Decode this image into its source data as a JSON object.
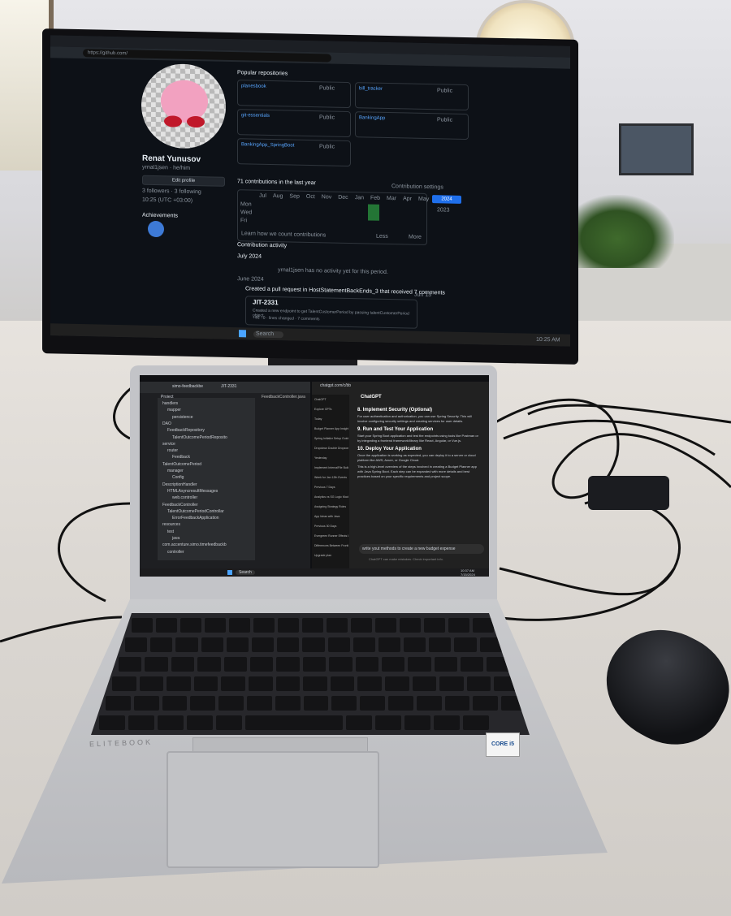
{
  "monitor": {
    "browser_url": "https://github.com/",
    "profile": {
      "name": "Renat Yunusov",
      "handle": "yrnal1jsen · he/him",
      "edit_button": "Edit profile",
      "followers": "3 followers · 3 following",
      "location": "10:25 (UTC +03:00)",
      "achievements_label": "Achievements"
    },
    "popular_heading": "Popular repositories",
    "repos": [
      {
        "name": "planesbook",
        "visibility": "Public"
      },
      {
        "name": "bill_tracker",
        "visibility": "Public"
      },
      {
        "name": "git-essentials",
        "visibility": "Public"
      },
      {
        "name": "BankingApp",
        "visibility": "Public"
      },
      {
        "name": "BankingApp_SpringBoot",
        "visibility": "Public"
      }
    ],
    "contributions_heading": "71 contributions in the last year",
    "contribution_settings": "Contribution settings",
    "year_button": "2024",
    "year_alt": "2023",
    "months": [
      "Jul",
      "Aug",
      "Sep",
      "Oct",
      "Nov",
      "Dec",
      "Jan",
      "Feb",
      "Mar",
      "Apr",
      "May",
      "Jun"
    ],
    "days": [
      "Mon",
      "Wed",
      "Fri"
    ],
    "learn_link": "Learn how we count contributions",
    "legend_less": "Less",
    "legend_more": "More",
    "activity_heading": "Contribution activity",
    "activity_month": "July 2024",
    "no_activity": "yrnal1jsen has no activity yet for this period.",
    "june_label": "June 2024",
    "pr_text": "Created a pull request in HostStatementBackEnds_3 that received 7 comments",
    "pr_date": "Jun 13",
    "pr_title": "JIT-2331",
    "pr_desc": "Created a new endpoint to get TalentCustomerPeriod by passing talentCustomerPeriod object",
    "pr_stats": "+46 −0 · lines changed · 7 comments",
    "search_label": "Search",
    "clock": "10:25 AM"
  },
  "laptop": {
    "ide": {
      "project_label": "Project",
      "tree": [
        "handlers",
        "mapper",
        "persistence",
        "DAO",
        "FeedbackRepository",
        "TalentOutcomePeriodReposito",
        "service",
        "router",
        "Feedback",
        "TalentOutcomePeriod",
        "manager",
        "Config",
        "DescriptionHandler",
        "HTMLAsyncresultMessages",
        "web.controller",
        "FeedbackController",
        "TalentOutcomePeriodControllar",
        "ErrorFeedbackApplication",
        "resources",
        "test",
        "java",
        "com.accenture.simo.timefeedbackb",
        "controller"
      ],
      "tab": "FeedbackController.java",
      "branch": "JIT-2331",
      "app": "simo-feedbackbe"
    },
    "chat": {
      "title": "ChatGPT",
      "url": "chatgpt.com/c/bb",
      "sidebar": [
        "ChatGPT",
        "Explore GPTs",
        "Today",
        "Budget Planner App Insights",
        "Spring Initializr Setup Guide",
        "Dropdown Double Dropzoning",
        "Yesterday",
        "Implement InternalFile Builder",
        "Week for Jan 12th Events",
        "Previous 7 Days",
        "Analytics vs SG Logic Models",
        "Assigning Strategy Roles",
        "App Ideas with Java",
        "Previous 30 Days",
        "Evergreen Runner Effects List",
        "Differences Between Frontiers",
        "Upgrade plan"
      ],
      "sections": [
        {
          "heading": "8. Implement Security (Optional)",
          "body": "For user authentication and authorization, you can use Spring Security. This will involve configuring security settings and creating services for user details."
        },
        {
          "heading": "9. Run and Test Your Application",
          "body": "Start your Spring Boot application and test the endpoints using tools like Postman or by integrating a frontend framework/library like React, Angular, or Vue.js."
        },
        {
          "heading": "10. Deploy Your Application",
          "body": "Once the application is working as expected, you can deploy it to a server or cloud platform like AWS, Azure, or Google Cloud."
        },
        {
          "heading": "",
          "body": "This is a high-level overview of the steps involved in creating a Budget Planner app with Java Spring Boot. Each step can be expanded with more details and best practices based on your specific requirements and project scope."
        }
      ],
      "input_placeholder": "write yout methods to create a new budget expense",
      "disclaimer": "ChatGPT can make mistakes. Check important info."
    },
    "search_label": "Search",
    "clock": "10:37 AM",
    "date": "7/15/2024",
    "brand": "ELITEBOOK",
    "badge": "CORE i5"
  }
}
